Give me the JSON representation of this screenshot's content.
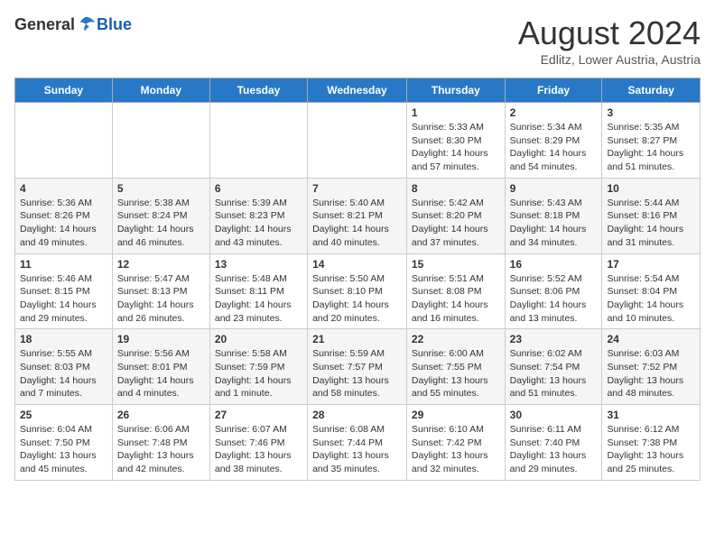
{
  "header": {
    "logo_general": "General",
    "logo_blue": "Blue",
    "month_year": "August 2024",
    "location": "Edlitz, Lower Austria, Austria"
  },
  "days_of_week": [
    "Sunday",
    "Monday",
    "Tuesday",
    "Wednesday",
    "Thursday",
    "Friday",
    "Saturday"
  ],
  "weeks": [
    [
      {
        "day": "",
        "content": ""
      },
      {
        "day": "",
        "content": ""
      },
      {
        "day": "",
        "content": ""
      },
      {
        "day": "",
        "content": ""
      },
      {
        "day": "1",
        "content": "Sunrise: 5:33 AM\nSunset: 8:30 PM\nDaylight: 14 hours and 57 minutes."
      },
      {
        "day": "2",
        "content": "Sunrise: 5:34 AM\nSunset: 8:29 PM\nDaylight: 14 hours and 54 minutes."
      },
      {
        "day": "3",
        "content": "Sunrise: 5:35 AM\nSunset: 8:27 PM\nDaylight: 14 hours and 51 minutes."
      }
    ],
    [
      {
        "day": "4",
        "content": "Sunrise: 5:36 AM\nSunset: 8:26 PM\nDaylight: 14 hours and 49 minutes."
      },
      {
        "day": "5",
        "content": "Sunrise: 5:38 AM\nSunset: 8:24 PM\nDaylight: 14 hours and 46 minutes."
      },
      {
        "day": "6",
        "content": "Sunrise: 5:39 AM\nSunset: 8:23 PM\nDaylight: 14 hours and 43 minutes."
      },
      {
        "day": "7",
        "content": "Sunrise: 5:40 AM\nSunset: 8:21 PM\nDaylight: 14 hours and 40 minutes."
      },
      {
        "day": "8",
        "content": "Sunrise: 5:42 AM\nSunset: 8:20 PM\nDaylight: 14 hours and 37 minutes."
      },
      {
        "day": "9",
        "content": "Sunrise: 5:43 AM\nSunset: 8:18 PM\nDaylight: 14 hours and 34 minutes."
      },
      {
        "day": "10",
        "content": "Sunrise: 5:44 AM\nSunset: 8:16 PM\nDaylight: 14 hours and 31 minutes."
      }
    ],
    [
      {
        "day": "11",
        "content": "Sunrise: 5:46 AM\nSunset: 8:15 PM\nDaylight: 14 hours and 29 minutes."
      },
      {
        "day": "12",
        "content": "Sunrise: 5:47 AM\nSunset: 8:13 PM\nDaylight: 14 hours and 26 minutes."
      },
      {
        "day": "13",
        "content": "Sunrise: 5:48 AM\nSunset: 8:11 PM\nDaylight: 14 hours and 23 minutes."
      },
      {
        "day": "14",
        "content": "Sunrise: 5:50 AM\nSunset: 8:10 PM\nDaylight: 14 hours and 20 minutes."
      },
      {
        "day": "15",
        "content": "Sunrise: 5:51 AM\nSunset: 8:08 PM\nDaylight: 14 hours and 16 minutes."
      },
      {
        "day": "16",
        "content": "Sunrise: 5:52 AM\nSunset: 8:06 PM\nDaylight: 14 hours and 13 minutes."
      },
      {
        "day": "17",
        "content": "Sunrise: 5:54 AM\nSunset: 8:04 PM\nDaylight: 14 hours and 10 minutes."
      }
    ],
    [
      {
        "day": "18",
        "content": "Sunrise: 5:55 AM\nSunset: 8:03 PM\nDaylight: 14 hours and 7 minutes."
      },
      {
        "day": "19",
        "content": "Sunrise: 5:56 AM\nSunset: 8:01 PM\nDaylight: 14 hours and 4 minutes."
      },
      {
        "day": "20",
        "content": "Sunrise: 5:58 AM\nSunset: 7:59 PM\nDaylight: 14 hours and 1 minute."
      },
      {
        "day": "21",
        "content": "Sunrise: 5:59 AM\nSunset: 7:57 PM\nDaylight: 13 hours and 58 minutes."
      },
      {
        "day": "22",
        "content": "Sunrise: 6:00 AM\nSunset: 7:55 PM\nDaylight: 13 hours and 55 minutes."
      },
      {
        "day": "23",
        "content": "Sunrise: 6:02 AM\nSunset: 7:54 PM\nDaylight: 13 hours and 51 minutes."
      },
      {
        "day": "24",
        "content": "Sunrise: 6:03 AM\nSunset: 7:52 PM\nDaylight: 13 hours and 48 minutes."
      }
    ],
    [
      {
        "day": "25",
        "content": "Sunrise: 6:04 AM\nSunset: 7:50 PM\nDaylight: 13 hours and 45 minutes."
      },
      {
        "day": "26",
        "content": "Sunrise: 6:06 AM\nSunset: 7:48 PM\nDaylight: 13 hours and 42 minutes."
      },
      {
        "day": "27",
        "content": "Sunrise: 6:07 AM\nSunset: 7:46 PM\nDaylight: 13 hours and 38 minutes."
      },
      {
        "day": "28",
        "content": "Sunrise: 6:08 AM\nSunset: 7:44 PM\nDaylight: 13 hours and 35 minutes."
      },
      {
        "day": "29",
        "content": "Sunrise: 6:10 AM\nSunset: 7:42 PM\nDaylight: 13 hours and 32 minutes."
      },
      {
        "day": "30",
        "content": "Sunrise: 6:11 AM\nSunset: 7:40 PM\nDaylight: 13 hours and 29 minutes."
      },
      {
        "day": "31",
        "content": "Sunrise: 6:12 AM\nSunset: 7:38 PM\nDaylight: 13 hours and 25 minutes."
      }
    ]
  ]
}
